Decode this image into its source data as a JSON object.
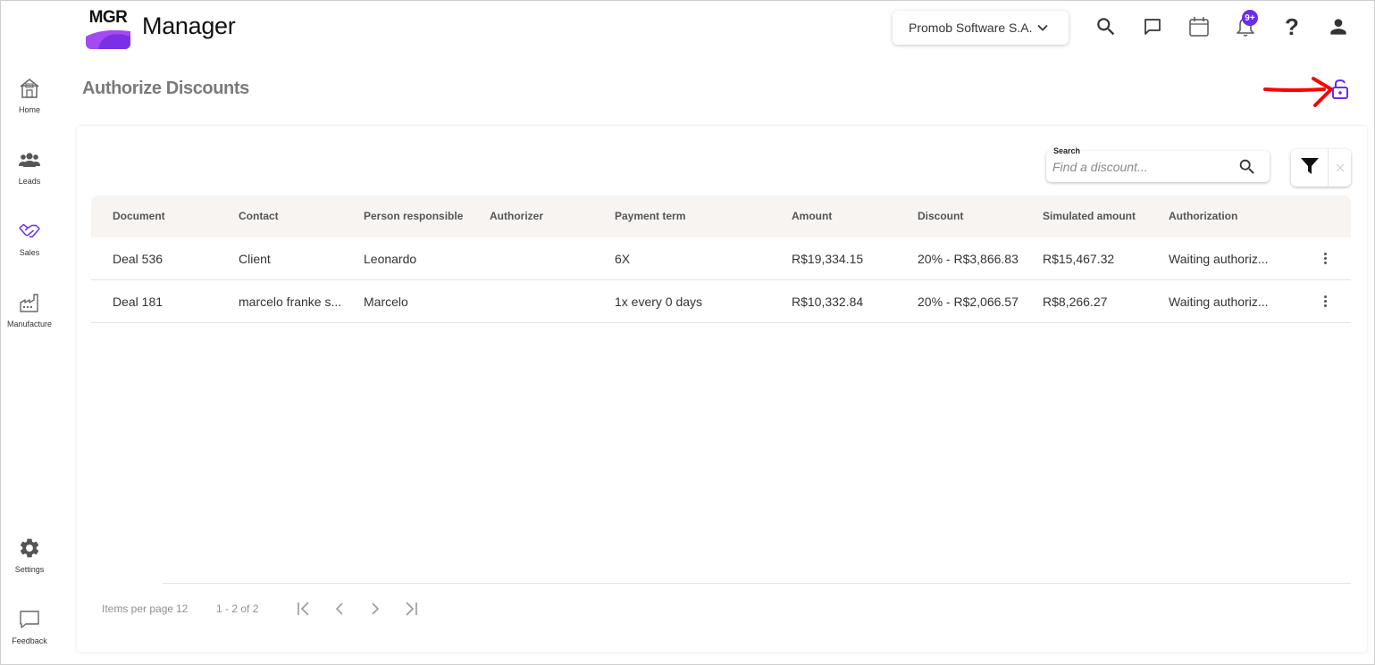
{
  "header": {
    "logo_text": "MGR",
    "app_title": "Manager",
    "company": "Promob Software S.A.",
    "notification_badge": "9+"
  },
  "sidebar": {
    "items": [
      {
        "label": "Home",
        "icon": "home-icon"
      },
      {
        "label": "Leads",
        "icon": "people-icon"
      },
      {
        "label": "Sales",
        "icon": "handshake-icon"
      },
      {
        "label": "Manufacture",
        "icon": "factory-icon"
      },
      {
        "label": "Settings",
        "icon": "gear-icon"
      },
      {
        "label": "Feedback",
        "icon": "feedback-icon"
      }
    ]
  },
  "page": {
    "title": "Authorize Discounts"
  },
  "search": {
    "label": "Search",
    "placeholder": "Find a discount..."
  },
  "table": {
    "columns": [
      "Document",
      "Contact",
      "Person responsible",
      "Authorizer",
      "Payment term",
      "Amount",
      "Discount",
      "Simulated amount",
      "Authorization"
    ],
    "rows": [
      {
        "document": "Deal 536",
        "contact": "Client",
        "responsible": "Leonardo",
        "authorizer": "",
        "payment_term": "6X",
        "amount": "R$19,334.15",
        "discount": "20% - R$3,866.83",
        "simulated": "R$15,467.32",
        "authorization": "Waiting authoriz..."
      },
      {
        "document": "Deal 181",
        "contact": "marcelo franke s...",
        "responsible": "Marcelo",
        "authorizer": "",
        "payment_term": "1x every 0 days",
        "amount": "R$10,332.84",
        "discount": "20% - R$2,066.57",
        "simulated": "R$8,266.27",
        "authorization": "Waiting authoriz..."
      }
    ]
  },
  "paginator": {
    "items_per_page_label": "Items per page",
    "items_per_page": "12",
    "range": "1 - 2 of 2"
  },
  "colors": {
    "accent": "#6a2bf5",
    "annotation_arrow": "#ff0000"
  }
}
